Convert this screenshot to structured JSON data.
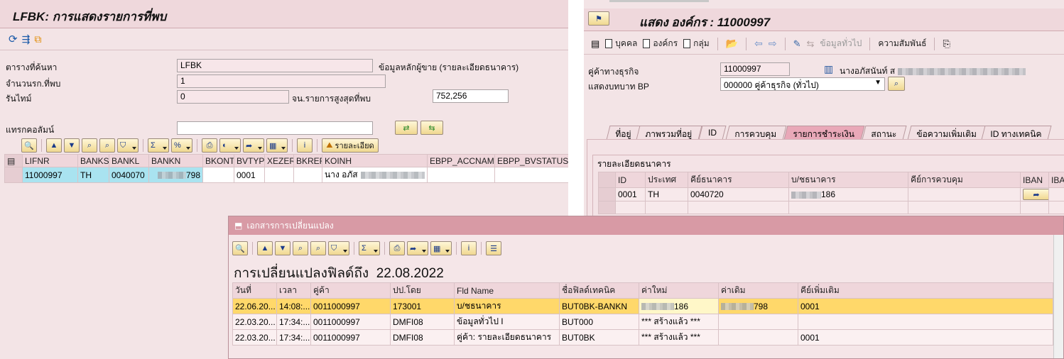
{
  "left": {
    "title": "LFBK: การแสดงรายการที่พบ",
    "fields": [
      {
        "label": "ตารางที่ค้นหา",
        "value": "LFBK",
        "desc": "ข้อมูลหลักผู้ขาย (รายละเอียดธนาคาร)"
      },
      {
        "label": "จำนวนรก.ที่พบ",
        "value": "1"
      },
      {
        "label": "รันไทม์",
        "value": "0",
        "label2": "จน.รายการสูงสุดที่พบ",
        "value2": "752,256"
      }
    ],
    "insert_col_label": "แทรกคอลัมน์",
    "details_button": "รายละเอียด",
    "columns": [
      "LIFNR",
      "BANKS",
      "BANKL",
      "BANKN",
      "BKONT",
      "BVTYP",
      "XEZER",
      "BKREF",
      "KOINH",
      "EBPP_ACCNAME",
      "EBPP_BVSTATUS"
    ],
    "row": {
      "LIFNR": "11000997",
      "BANKS": "TH",
      "BANKL": "0040070",
      "BANKN_suffix": "798",
      "BKONT": "",
      "BVTYP": "0001",
      "XEZER": "",
      "BKREF": "",
      "KOINH": "นาง อภัส",
      "EBPP_ACCNAME": "",
      "EBPP_BVSTATUS": ""
    }
  },
  "right": {
    "title": "แสดง องค์กร : 11000997",
    "menu": {
      "person": "บุคคล",
      "org": "องค์กร",
      "group": "กลุ่ม",
      "general": "ข้อมูลทั่วไป",
      "relation": "ความสัมพันธ์"
    },
    "bp_label": "คู่ค้าทางธุรกิจ",
    "bp_value": "11000997",
    "bp_name": "นางอภัสนันท์ ส",
    "role_label": "แสดงบทบาท BP",
    "role_value": "000000 คู่ค้าธุรกิจ (ทั่วไป)",
    "tabs": [
      "ที่อยู่",
      "ภาพรวมที่อยู่",
      "ID",
      "การควบคุม",
      "รายการชำระเงิน",
      "สถานะ",
      "ข้อความเพิ่มเติม",
      "ID ทางเทคนิค"
    ],
    "active_tab": "รายการชำระเงิน",
    "section_title": "รายละเอียดธนาคาร",
    "columns": [
      "ID",
      "ประเทศ",
      "คีย์ธนาคาร",
      "บ/ชธนาคาร",
      "คีย์การควบคุม",
      "IBAN",
      "IBA"
    ],
    "row": {
      "id": "0001",
      "country": "TH",
      "bank_key": "0040720",
      "account_suffix": "186"
    }
  },
  "dialog": {
    "title": "เอกสารการเปลี่ยนแปลง",
    "heading": "การเปลี่ยนแปลงฟิลด์ถึง  22.08.2022",
    "columns": [
      "วันที่",
      "เวลา",
      "คู่ค้า",
      "ปป.โดย",
      "Fld Name",
      "ชื่อฟิลด์เทคนิค",
      "ค่าใหม่",
      "ค่าเดิม",
      "คีย์เพิ่มเติม"
    ],
    "rows": [
      {
        "date": "22.06.20...",
        "time": "14:08:...",
        "partner": "0011000997",
        "by": "173001",
        "fld": "บ/ชธนาคาร",
        "tech": "BUT0BK-BANKN",
        "new": "186",
        "old": "798",
        "key": "0001",
        "highlight": true
      },
      {
        "date": "22.03.20...",
        "time": "17:34:...",
        "partner": "0011000997",
        "by": "DMFI08",
        "fld": "ข้อมูลทั่วไป I",
        "tech": "BUT000",
        "new": "*** สร้างแล้ว ***",
        "old": "",
        "key": ""
      },
      {
        "date": "22.03.20...",
        "time": "17:34:...",
        "partner": "0011000997",
        "by": "DMFI08",
        "fld": "คู่ค้า: รายละเอียดธนาคาร",
        "tech": "BUT0BK",
        "new": "*** สร้างแล้ว ***",
        "old": "",
        "key": "0001"
      }
    ]
  },
  "colors": {
    "sap_bg": "#f3e4e6",
    "highlight_row": "#ffd86a",
    "selected_row": "#a9e3f0",
    "active_tab": "#e9a8b8"
  }
}
